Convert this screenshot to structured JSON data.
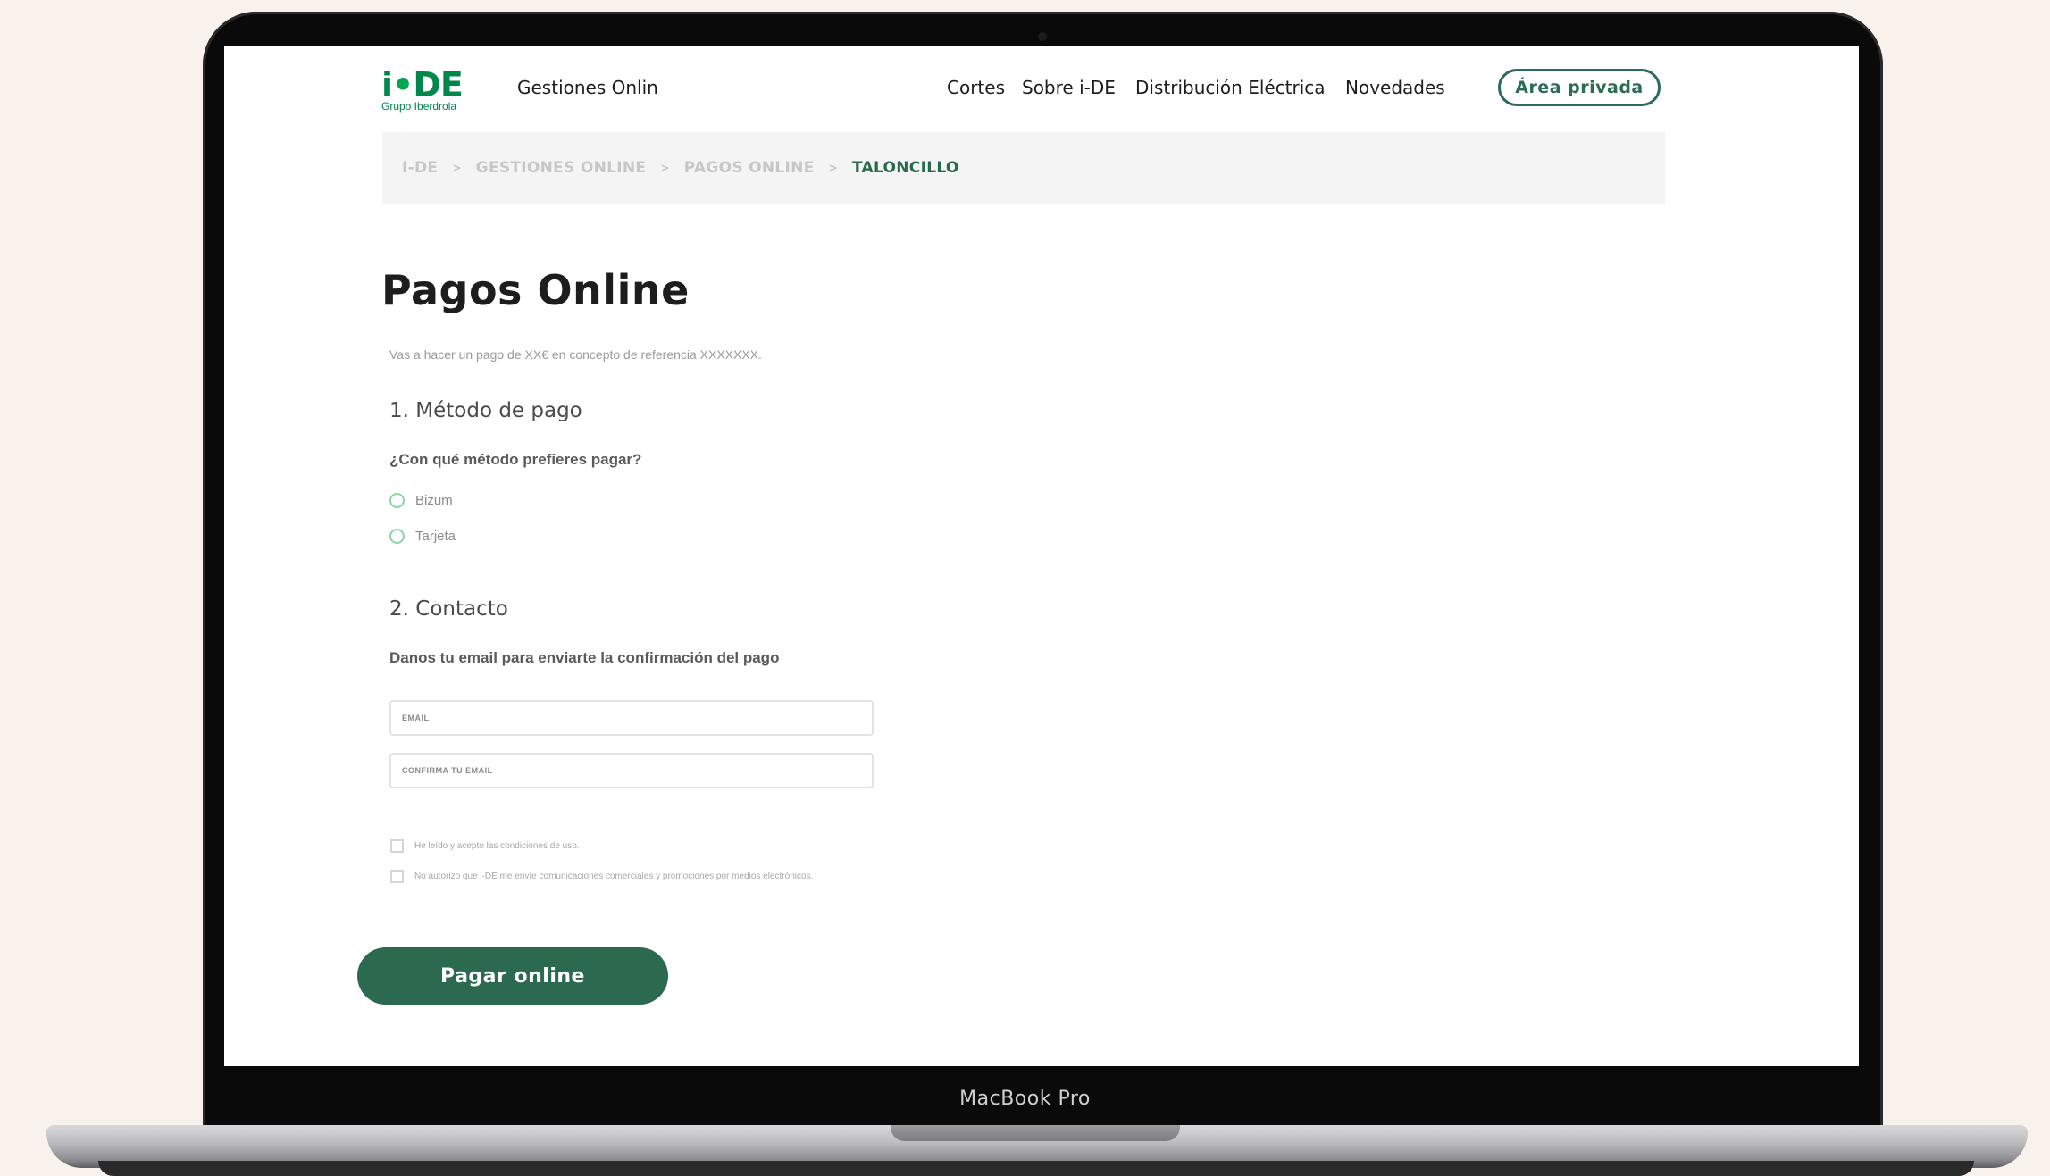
{
  "device": {
    "label": "MacBook Pro"
  },
  "header": {
    "logo_main_prefix": "i",
    "logo_main_dot": "•",
    "logo_main_suffix": "DE",
    "logo_sub": "Grupo Iberdrola",
    "nav": [
      "Gestiones Onlin",
      "Cortes",
      "Sobre i-DE",
      "Distribución Eléctrica",
      "Novedades"
    ],
    "private_area": "Área privada"
  },
  "breadcrumb": {
    "items": [
      "I-DE",
      "GESTIONES ONLINE",
      "PAGOS ONLINE",
      "TALONCILLO"
    ],
    "separator": ">"
  },
  "main": {
    "title": "Pagos Online",
    "intro": "Vas a hacer un pago de XX€ en concepto de referencia XXXXXXX.",
    "section1": {
      "heading": "1. Método de pago",
      "question": "¿Con qué método prefieres pagar?",
      "options": [
        "Bizum",
        "Tarjeta"
      ]
    },
    "section2": {
      "heading": "2. Contacto",
      "question": "Danos tu email para enviarte la confirmación del pago",
      "email_placeholder": "EMAIL",
      "confirm_placeholder": "CONFIRMA TU EMAIL"
    },
    "checks": [
      "He leído y acepto las condiciones de uso.",
      "No autorizo que i-DE me envíe comunicaciones comerciales y promociones por medios electrónicos."
    ],
    "pay_button": "Pagar online"
  }
}
